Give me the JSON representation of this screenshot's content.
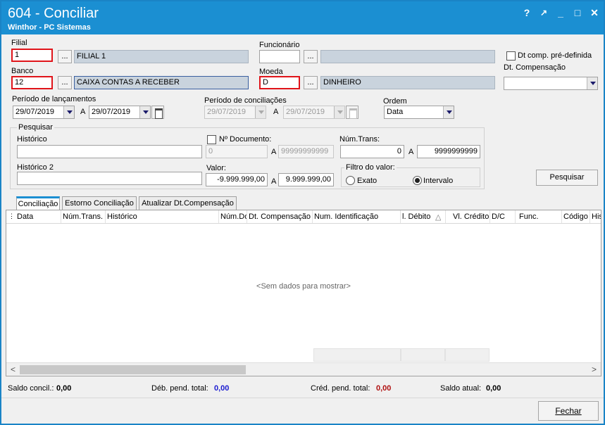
{
  "window": {
    "title": "604 - Conciliar",
    "subtitle": "Winthor - PC Sistemas",
    "buttons": [
      "?",
      "↗",
      "_",
      "□",
      "✕"
    ]
  },
  "form": {
    "filial": {
      "label": "Filial",
      "code": "1",
      "browse": "...",
      "name": "FILIAL 1"
    },
    "funcionario": {
      "label": "Funcionário",
      "code": "",
      "browse": "...",
      "name": ""
    },
    "dt_comp_predef": {
      "label": "Dt comp. pré-definida",
      "checked": false
    },
    "dt_compensacao": {
      "label": "Dt. Compensação",
      "value": ""
    },
    "banco": {
      "label": "Banco",
      "code": "12",
      "browse": "...",
      "name": "CAIXA CONTAS A RECEBER"
    },
    "moeda": {
      "label": "Moeda",
      "code": "D",
      "browse": "...",
      "name": "DINHEIRO"
    },
    "periodo_lancamentos": {
      "label": "Período de lançamentos",
      "from": "29/07/2019",
      "sep": "A",
      "to": "29/07/2019"
    },
    "periodo_conciliacoes": {
      "label": "Período de conciliações",
      "from": "29/07/2019",
      "sep": "A",
      "to": "29/07/2019"
    },
    "ordem": {
      "label": "Ordem",
      "value": "Data"
    }
  },
  "pesquisar": {
    "group_label": "Pesquisar",
    "historico": {
      "label": "Histórico",
      "value": ""
    },
    "historico2": {
      "label": "Histórico 2",
      "value": ""
    },
    "num_documento": {
      "label": "Nº Documento:",
      "checked": false,
      "from": "0",
      "sep": "A",
      "to": "99999999999"
    },
    "num_trans": {
      "label": "Núm.Trans:",
      "from": "0",
      "sep": "A",
      "to": "9999999999"
    },
    "valor": {
      "label": "Valor:",
      "from": "-9.999.999,00",
      "sep": "A",
      "to": "9.999.999,00"
    },
    "filtro_valor": {
      "label": "Filtro do valor:",
      "options": [
        "Exato",
        "Intervalo"
      ],
      "selected": "Intervalo"
    },
    "button": "Pesquisar"
  },
  "tabs": [
    {
      "label": "Conciliação",
      "active": true
    },
    {
      "label": "Estorno Conciliação",
      "active": false
    },
    {
      "label": "Atualizar Dt.Compensação",
      "active": false
    }
  ],
  "grid": {
    "columns": [
      "Data",
      "Núm.Trans.",
      "Histórico",
      "Núm.Do",
      "Dt. Compensação",
      "Num. Identificação",
      "l. Débito",
      "Vl. Crédito",
      "D/C",
      "Func.",
      "Código",
      "His"
    ],
    "empty_text": "<Sem dados para mostrar>",
    "scroll_left": "<",
    "scroll_right": ">"
  },
  "summary": {
    "saldo_concil": {
      "label": "Saldo concil.:",
      "value": "0,00",
      "color": "#000000"
    },
    "deb_pend": {
      "label": "Déb. pend. total:",
      "value": "0,00",
      "color": "#1a1ad0"
    },
    "cred_pend": {
      "label": "Créd. pend. total:",
      "value": "0,00",
      "color": "#b01010"
    },
    "saldo_atual": {
      "label": "Saldo atual:",
      "value": "0,00",
      "color": "#000000"
    }
  },
  "fechar_button": "Fechar"
}
